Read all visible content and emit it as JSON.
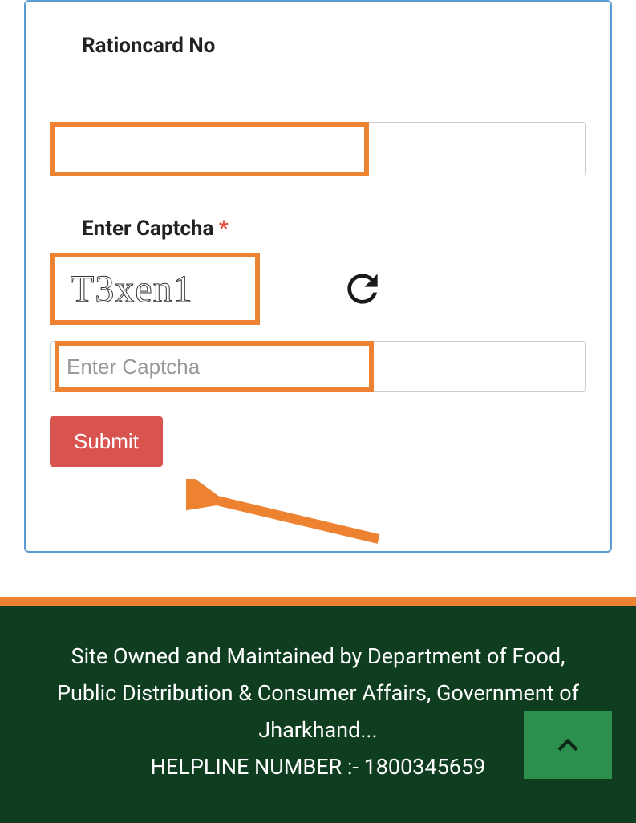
{
  "form": {
    "rationcard_label": "Rationcard No",
    "rationcard_value": "",
    "captcha_label": "Enter Captcha",
    "required_marker": "*",
    "captcha_text": "T3xen1",
    "captcha_placeholder": "Enter Captcha",
    "captcha_value": "",
    "submit_label": "Submit"
  },
  "footer": {
    "line1": "Site Owned and Maintained by Department of Food, Public Distribution & Consumer Affairs, Government of Jharkhand...",
    "helpline": "HELPLINE NUMBER :- 1800345659"
  },
  "icons": {
    "refresh": "refresh-icon",
    "scroll_top": "chevron-up-icon"
  }
}
